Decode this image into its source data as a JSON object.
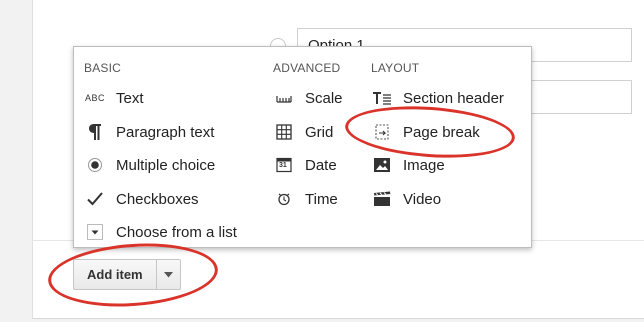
{
  "form": {
    "option1_value": "Option 1"
  },
  "menu": {
    "basic": {
      "heading": "BASIC",
      "items": [
        {
          "label": "Text",
          "icon": "abc-text-icon",
          "icon_text": "ABC"
        },
        {
          "label": "Paragraph text",
          "icon": "paragraph-icon"
        },
        {
          "label": "Multiple choice",
          "icon": "radio-icon"
        },
        {
          "label": "Checkboxes",
          "icon": "checkmark-icon"
        },
        {
          "label": "Choose from a list",
          "icon": "dropdown-icon"
        }
      ]
    },
    "advanced": {
      "heading": "ADVANCED",
      "items": [
        {
          "label": "Scale",
          "icon": "scale-icon"
        },
        {
          "label": "Grid",
          "icon": "grid-icon"
        },
        {
          "label": "Date",
          "icon": "calendar-icon",
          "icon_text": "31"
        },
        {
          "label": "Time",
          "icon": "clock-icon"
        }
      ]
    },
    "layout": {
      "heading": "LAYOUT",
      "items": [
        {
          "label": "Section header",
          "icon": "section-header-icon"
        },
        {
          "label": "Page break",
          "icon": "page-break-icon"
        },
        {
          "label": "Image",
          "icon": "image-icon"
        },
        {
          "label": "Video",
          "icon": "video-icon"
        }
      ]
    }
  },
  "toolbar": {
    "add_item_label": "Add item"
  },
  "colors": {
    "highlight": "#d9332a",
    "menu_border": "#bdbdbd"
  }
}
